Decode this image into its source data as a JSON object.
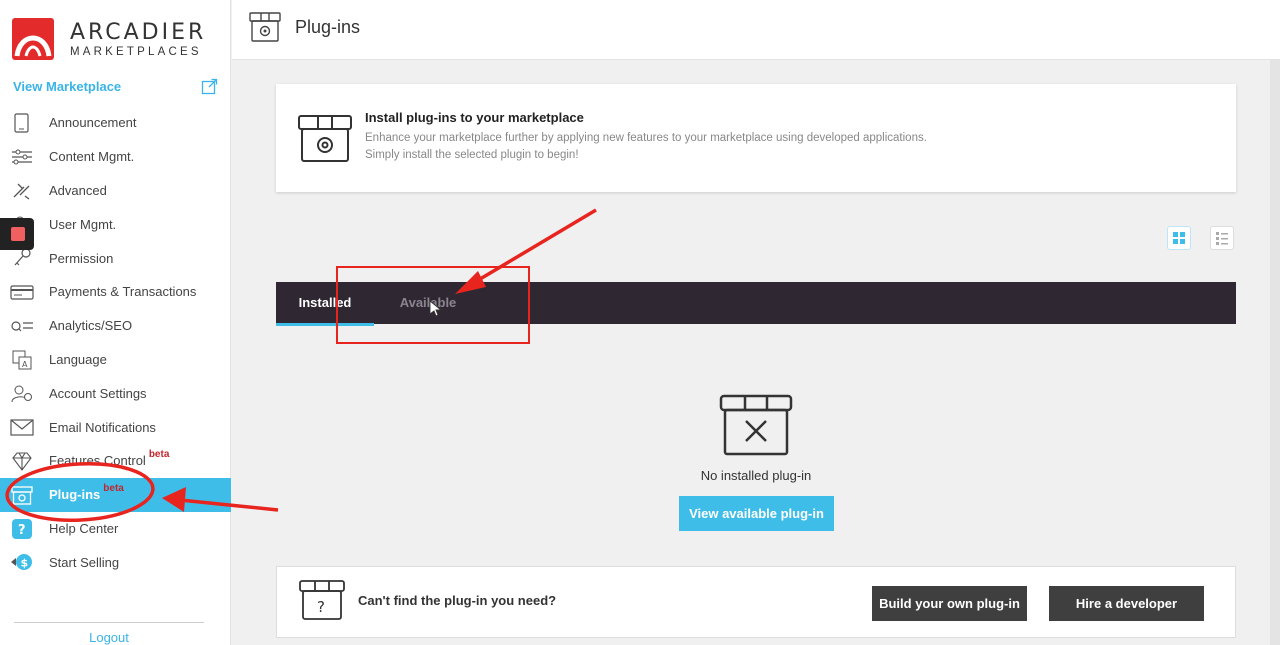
{
  "brand": {
    "name": "ARCADIER",
    "sub": "MARKETPLACES",
    "color": "#e32b2b"
  },
  "sidebar": {
    "view_marketplace": "View Marketplace",
    "items": [
      {
        "label": "Announcement",
        "icon": "tablet-icon"
      },
      {
        "label": "Content Mgmt.",
        "icon": "sliders-icon"
      },
      {
        "label": "Advanced",
        "icon": "advanced-tools-icon"
      },
      {
        "label": "User Mgmt.",
        "icon": "users-icon"
      },
      {
        "label": "Permission",
        "icon": "key-icon"
      },
      {
        "label": "Payments & Transactions",
        "icon": "credit-card-icon"
      },
      {
        "label": "Analytics/SEO",
        "icon": "search-list-icon"
      },
      {
        "label": "Language",
        "icon": "translate-icon"
      },
      {
        "label": "Account Settings",
        "icon": "account-gear-icon"
      },
      {
        "label": "Email Notifications",
        "icon": "envelope-icon"
      },
      {
        "label": "Features Control",
        "beta": "beta",
        "icon": "diamond-icon"
      },
      {
        "label": "Plug-ins",
        "beta": "beta",
        "icon": "plugin-box-icon",
        "active": true
      },
      {
        "label": "Help Center",
        "icon": "question-icon"
      },
      {
        "label": "Start Selling",
        "icon": "dollar-icon"
      }
    ],
    "logout": "Logout"
  },
  "header": {
    "title": "Plug-ins"
  },
  "info": {
    "title": "Install plug-ins to your marketplace",
    "line1": "Enhance your marketplace further by applying new features to your marketplace using developed applications.",
    "line2": "Simply install the selected plugin to begin!"
  },
  "tabs": {
    "installed": "Installed",
    "available": "Available",
    "active": "installed"
  },
  "empty": {
    "message": "No installed plug-in",
    "button": "View available plug-in"
  },
  "help": {
    "question": "Can't find the plug-in you need?",
    "build_button": "Build your own plug-in",
    "hire_button": "Hire a developer"
  },
  "colors": {
    "accent": "#3fbde9",
    "tabbar": "#2f2833",
    "annotation": "#e8241f",
    "beta": "#c0262d"
  }
}
